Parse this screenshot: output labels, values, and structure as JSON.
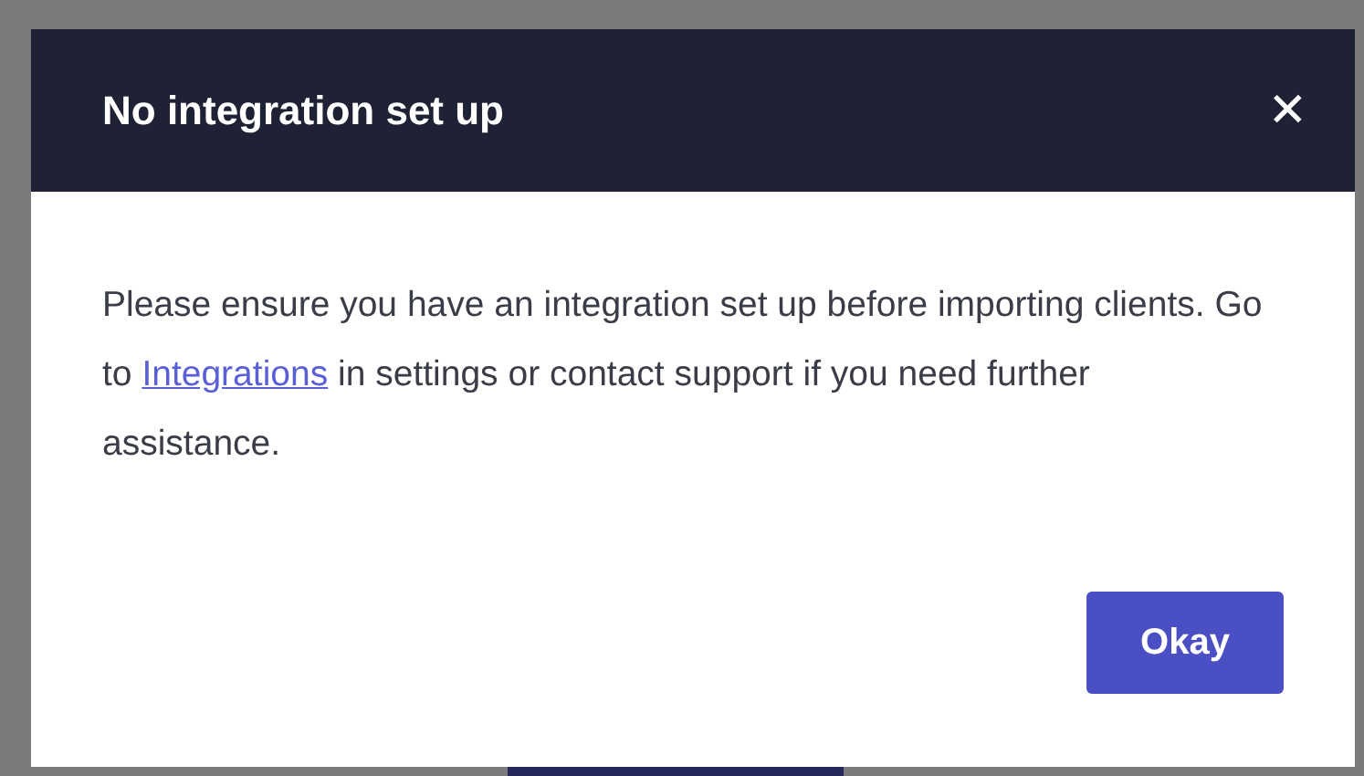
{
  "dialog": {
    "title": "No integration set up",
    "close": "✕",
    "message": {
      "before": "Please ensure you have an integration set up before importing clients. Go to ",
      "link": "Integrations",
      "after": " in settings or contact support if you need further assistance."
    },
    "buttons": [
      "Okay"
    ]
  }
}
